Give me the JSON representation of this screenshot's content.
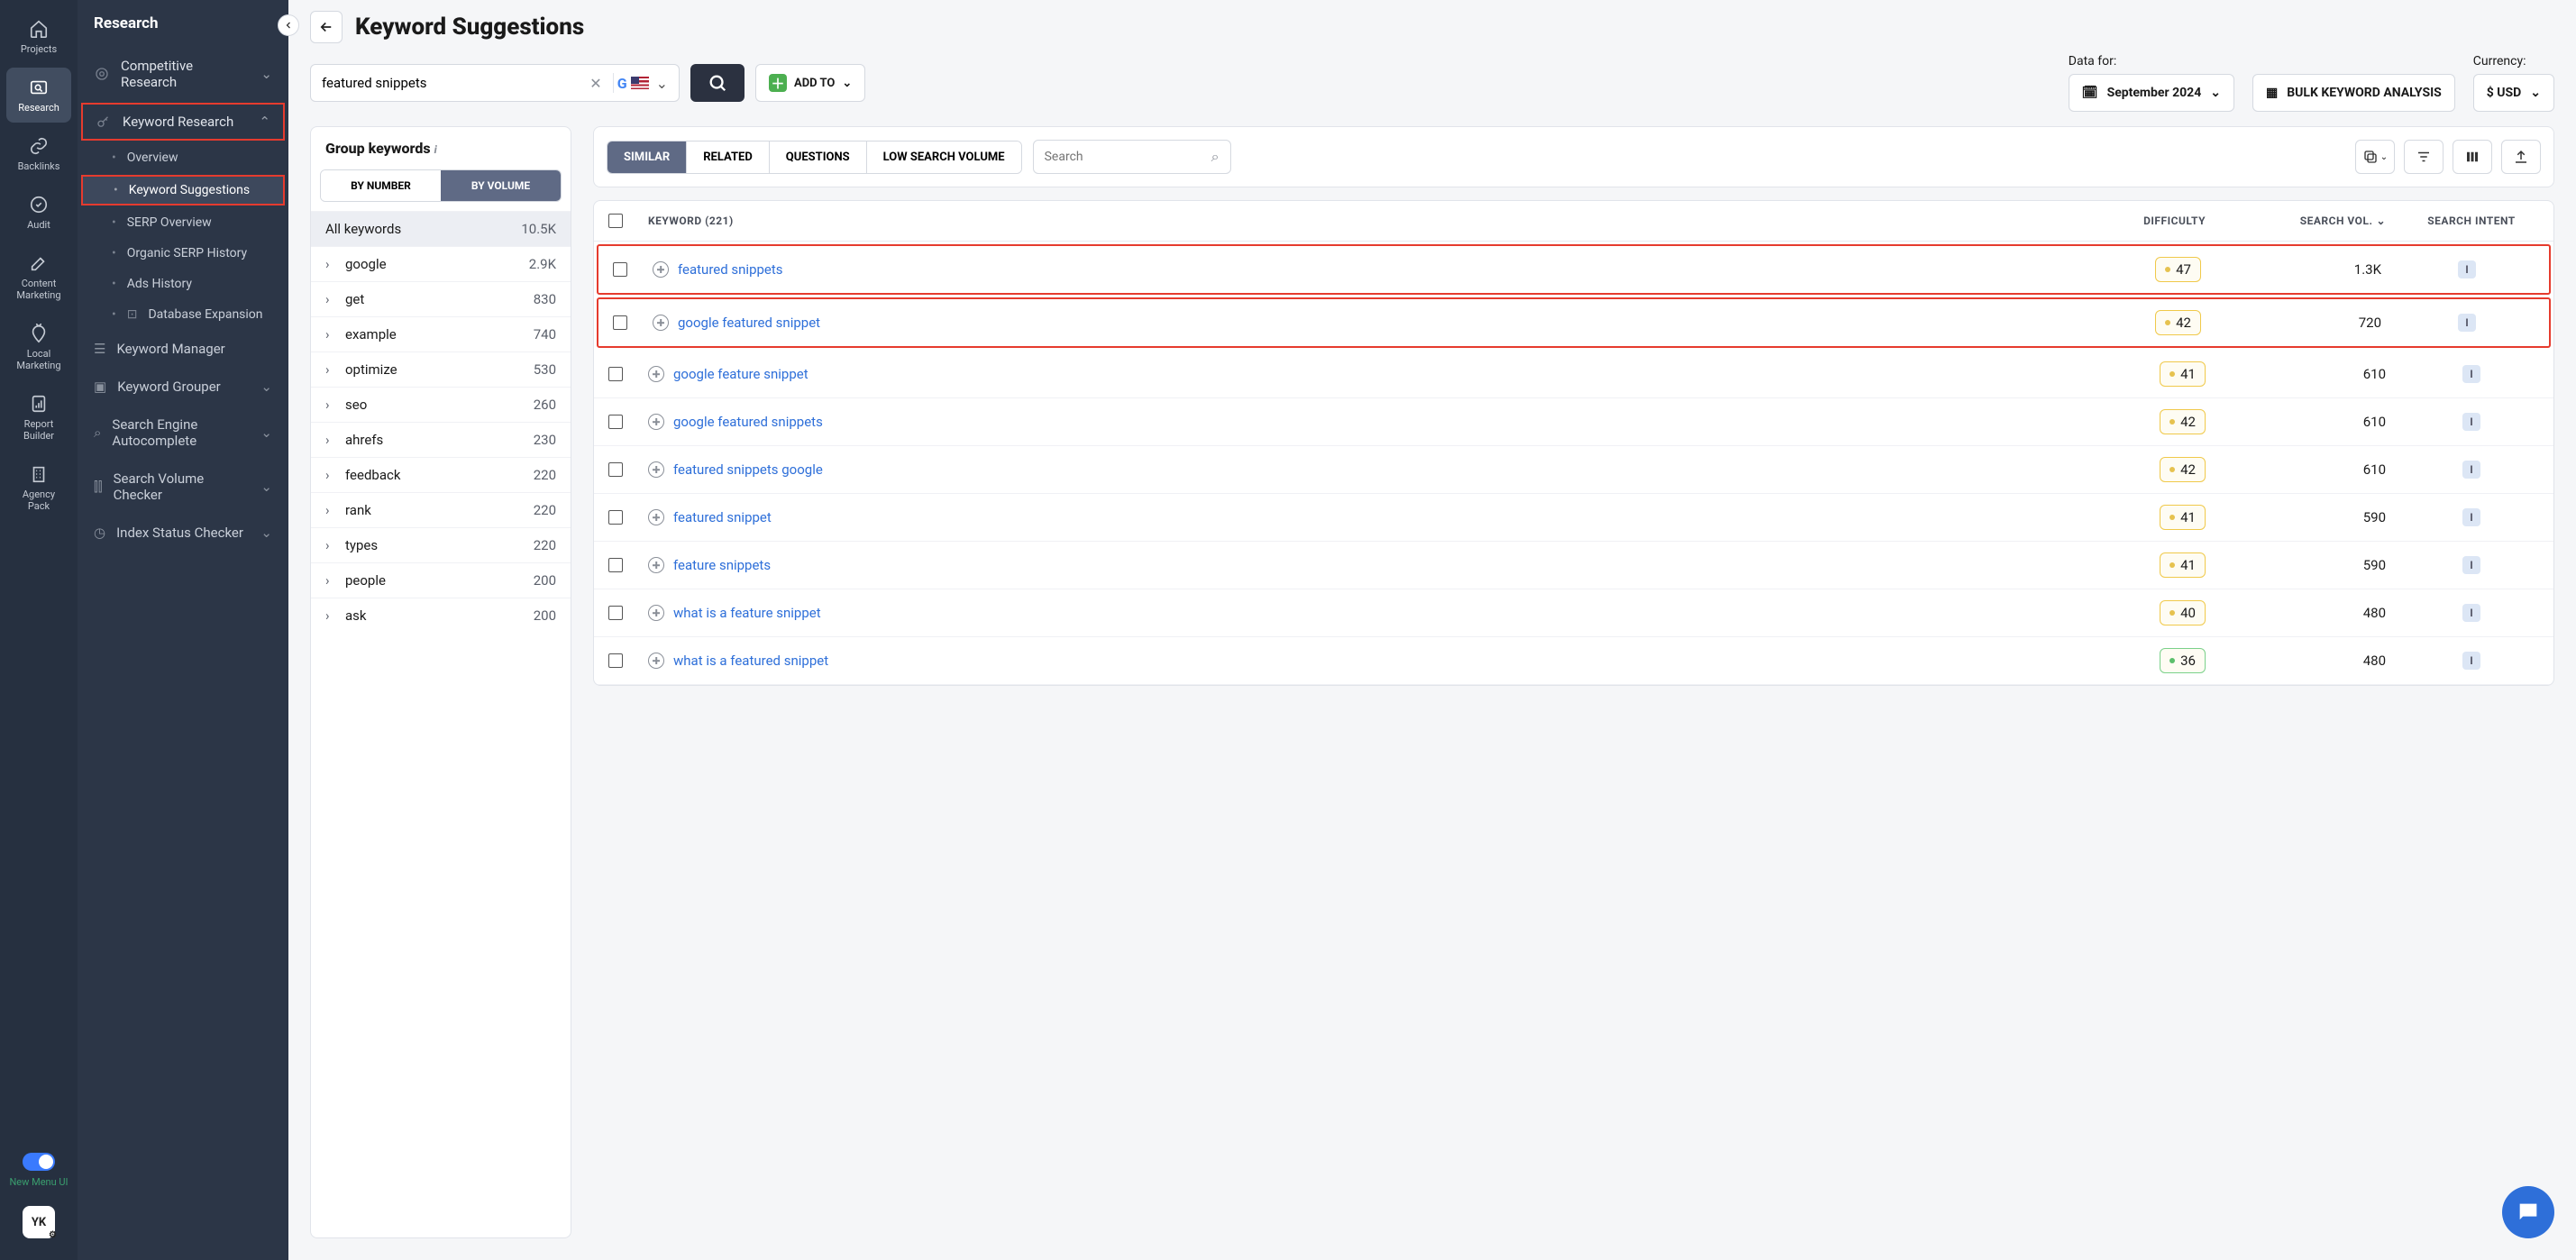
{
  "icon_sidebar": {
    "items": [
      {
        "label": "Projects"
      },
      {
        "label": "Research"
      },
      {
        "label": "Backlinks"
      },
      {
        "label": "Audit"
      },
      {
        "label": "Content Marketing"
      },
      {
        "label": "Local Marketing"
      },
      {
        "label": "Report Builder"
      },
      {
        "label": "Agency Pack"
      }
    ],
    "new_menu": "New Menu UI",
    "avatar": "YK"
  },
  "menu": {
    "title": "Research",
    "competitive": "Competitive Research",
    "keyword_research": "Keyword Research",
    "kr_items": {
      "overview": "Overview",
      "suggestions": "Keyword Suggestions",
      "serp_overview": "SERP Overview",
      "organic_serp": "Organic SERP History",
      "ads_history": "Ads History",
      "db_expansion": "Database Expansion"
    },
    "keyword_manager": "Keyword Manager",
    "keyword_grouper": "Keyword Grouper",
    "se_autocomplete": "Search Engine Autocomplete",
    "sv_checker": "Search Volume Checker",
    "index_checker": "Index Status Checker"
  },
  "page": {
    "title": "Keyword Suggestions",
    "search_value": "featured snippets"
  },
  "toolbar": {
    "add_to": "ADD TO",
    "data_for_label": "Data for:",
    "data_for_value": "September 2024",
    "bulk_label": "BULK KEYWORD ANALYSIS",
    "currency_label": "Currency:",
    "currency_value": "$ USD"
  },
  "groups": {
    "title": "Group keywords",
    "by_number": "BY NUMBER",
    "by_volume": "BY VOLUME",
    "all_label": "All keywords",
    "all_count": "10.5K",
    "items": [
      {
        "label": "google",
        "count": "2.9K"
      },
      {
        "label": "get",
        "count": "830"
      },
      {
        "label": "example",
        "count": "740"
      },
      {
        "label": "optimize",
        "count": "530"
      },
      {
        "label": "seo",
        "count": "260"
      },
      {
        "label": "ahrefs",
        "count": "230"
      },
      {
        "label": "feedback",
        "count": "220"
      },
      {
        "label": "rank",
        "count": "220"
      },
      {
        "label": "types",
        "count": "220"
      },
      {
        "label": "people",
        "count": "200"
      },
      {
        "label": "ask",
        "count": "200"
      }
    ]
  },
  "table": {
    "tabs": {
      "similar": "SIMILAR",
      "related": "RELATED",
      "questions": "QUESTIONS",
      "low_volume": "LOW SEARCH VOLUME"
    },
    "search_placeholder": "Search",
    "headers": {
      "keyword": "KEYWORD",
      "keyword_count": "(221)",
      "difficulty": "DIFFICULTY",
      "volume": "SEARCH VOL.",
      "intent": "SEARCH INTENT"
    },
    "rows": [
      {
        "keyword": "featured snippets",
        "difficulty": "47",
        "volume": "1.3K",
        "intent": "I",
        "hi": true,
        "diff_class": ""
      },
      {
        "keyword": "google featured snippet",
        "difficulty": "42",
        "volume": "720",
        "intent": "I",
        "hi": true,
        "diff_class": ""
      },
      {
        "keyword": "google feature snippet",
        "difficulty": "41",
        "volume": "610",
        "intent": "I",
        "hi": false,
        "diff_class": ""
      },
      {
        "keyword": "google featured snippets",
        "difficulty": "42",
        "volume": "610",
        "intent": "I",
        "hi": false,
        "diff_class": ""
      },
      {
        "keyword": "featured snippets google",
        "difficulty": "42",
        "volume": "610",
        "intent": "I",
        "hi": false,
        "diff_class": ""
      },
      {
        "keyword": "featured snippet",
        "difficulty": "41",
        "volume": "590",
        "intent": "I",
        "hi": false,
        "diff_class": ""
      },
      {
        "keyword": "feature snippets",
        "difficulty": "41",
        "volume": "590",
        "intent": "I",
        "hi": false,
        "diff_class": ""
      },
      {
        "keyword": "what is a feature snippet",
        "difficulty": "40",
        "volume": "480",
        "intent": "I",
        "hi": false,
        "diff_class": ""
      },
      {
        "keyword": "what is a featured snippet",
        "difficulty": "36",
        "volume": "480",
        "intent": "I",
        "hi": false,
        "diff_class": "green"
      }
    ]
  }
}
